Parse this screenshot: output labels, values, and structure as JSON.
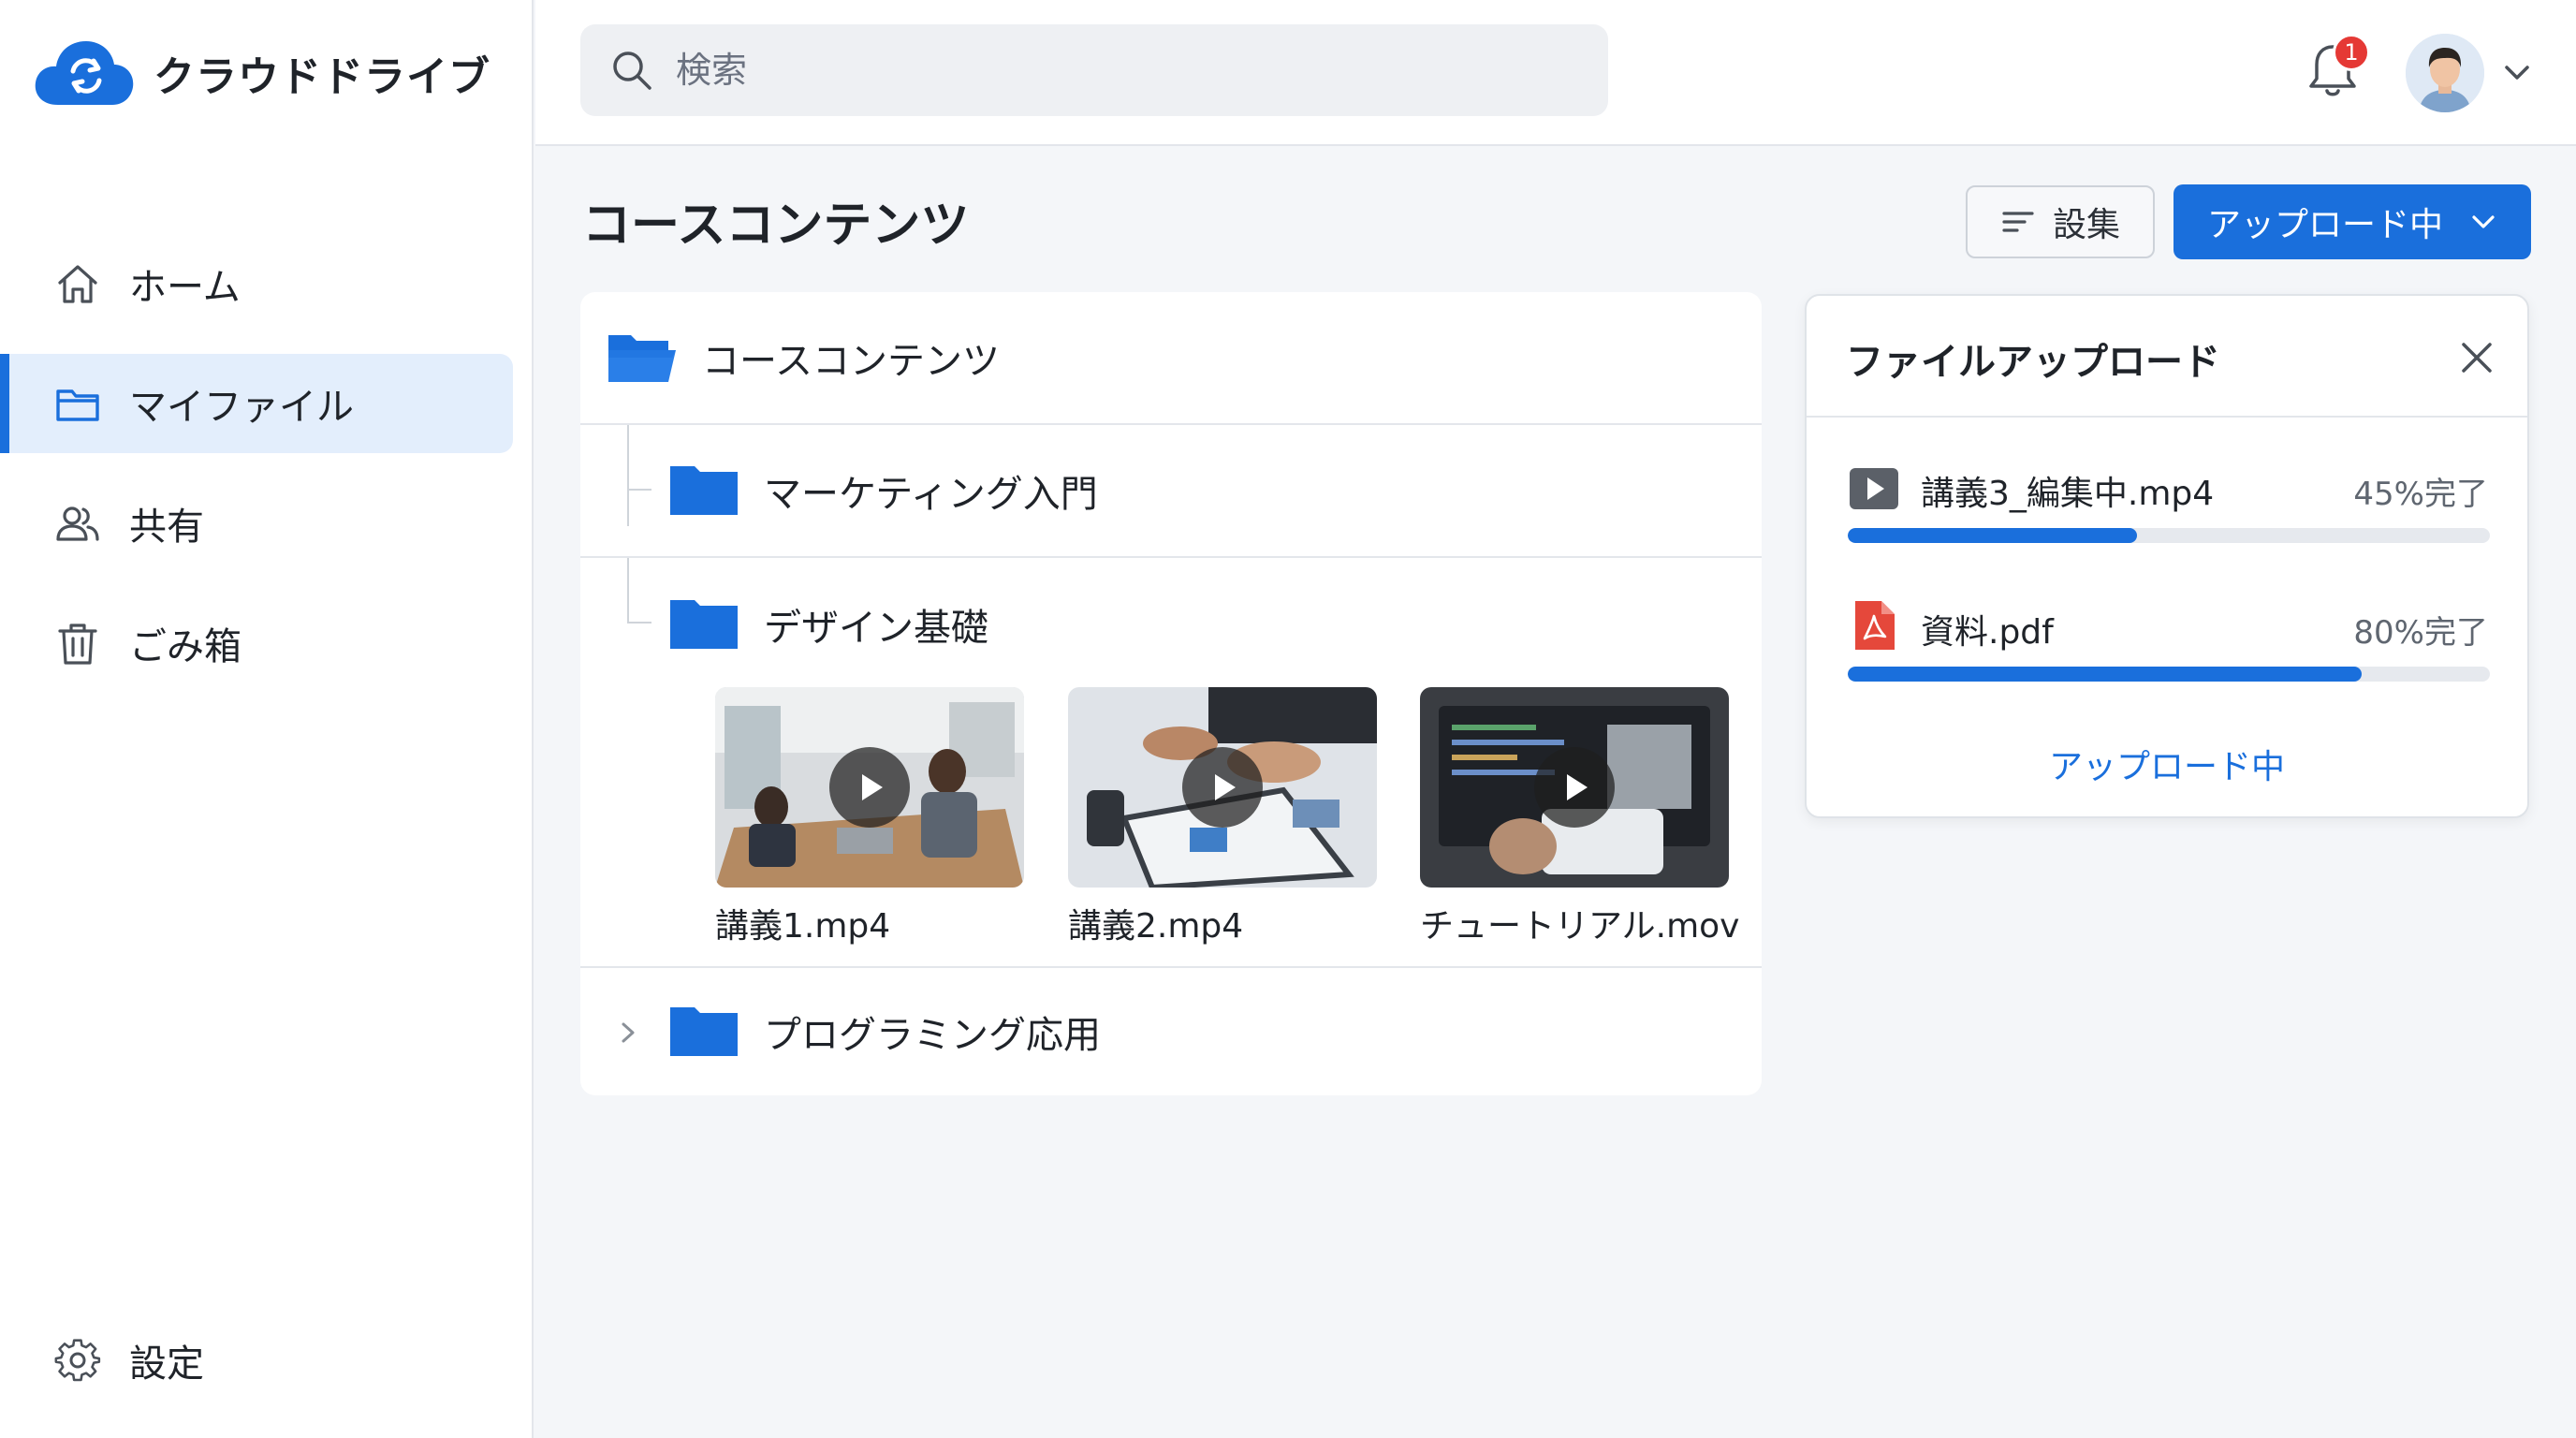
{
  "app": {
    "name": "クラウドドライブ"
  },
  "sidebar": {
    "items": [
      {
        "label": "ホーム",
        "icon": "home-icon",
        "active": false
      },
      {
        "label": "マイファイル",
        "icon": "folder-icon",
        "active": true
      },
      {
        "label": "共有",
        "icon": "users-icon",
        "active": false
      },
      {
        "label": "ごみ箱",
        "icon": "trash-icon",
        "active": false
      }
    ],
    "settings": {
      "label": "設定",
      "icon": "gear-icon"
    }
  },
  "topbar": {
    "search": {
      "placeholder": "検索",
      "value": ""
    },
    "notifications": {
      "count": "1"
    }
  },
  "page": {
    "title": "コースコンテンツ",
    "edit_label": "設集",
    "upload_label": "アップロード中"
  },
  "tree": {
    "root": {
      "label": "コースコンテンツ"
    },
    "folders": [
      {
        "label": "マーケティング入門",
        "expanded": false
      },
      {
        "label": "デザイン基礎",
        "expanded": true
      },
      {
        "label": "プログラミング応用",
        "expanded": false
      }
    ],
    "videos": [
      {
        "name": "講義1.mp4"
      },
      {
        "name": "講義2.mp4"
      },
      {
        "name": "チュートリアル.mov"
      }
    ]
  },
  "upload_panel": {
    "title": "ファイルアップロード",
    "items": [
      {
        "name": "講義3_編集中.mp4",
        "progress_text": "45%完了",
        "progress": 0.45,
        "type": "video"
      },
      {
        "name": "資料.pdf",
        "progress_text": "80%完了",
        "progress": 0.8,
        "type": "pdf"
      }
    ],
    "footer": "アップロード中"
  },
  "colors": {
    "accent": "#1a6fdc",
    "badge": "#e53935",
    "pdf": "#e5483b"
  }
}
